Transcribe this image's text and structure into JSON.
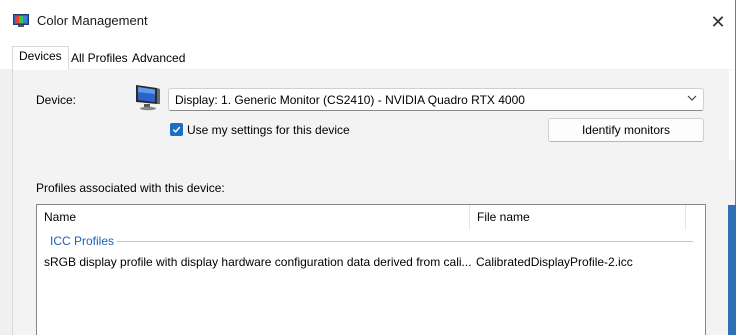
{
  "window": {
    "title": "Color Management",
    "icon": "color-management-icon",
    "close_glyph": "✕"
  },
  "tabs": [
    {
      "label": "Devices",
      "active": true
    },
    {
      "label": "All Profiles",
      "active": false
    },
    {
      "label": "Advanced",
      "active": false
    }
  ],
  "device": {
    "label": "Device:",
    "selected": "Display: 1. Generic Monitor (CS2410) - NVIDIA Quadro RTX 4000",
    "icon": "monitor-icon",
    "use_my_settings_label": "Use my settings for this device",
    "use_my_settings_checked": true,
    "identify_button": "Identify monitors"
  },
  "profiles": {
    "label": "Profiles associated with this device:",
    "columns": [
      "Name",
      "File name"
    ],
    "group": "ICC Profiles",
    "rows": [
      {
        "name": "sRGB display profile with display hardware configuration data derived from cali...",
        "file": "CalibratedDisplayProfile-2.icc"
      }
    ]
  },
  "colors": {
    "accent": "#1a6fc4",
    "group_text": "#1f5fbf",
    "desktop_edge": "#2f6fb7"
  }
}
